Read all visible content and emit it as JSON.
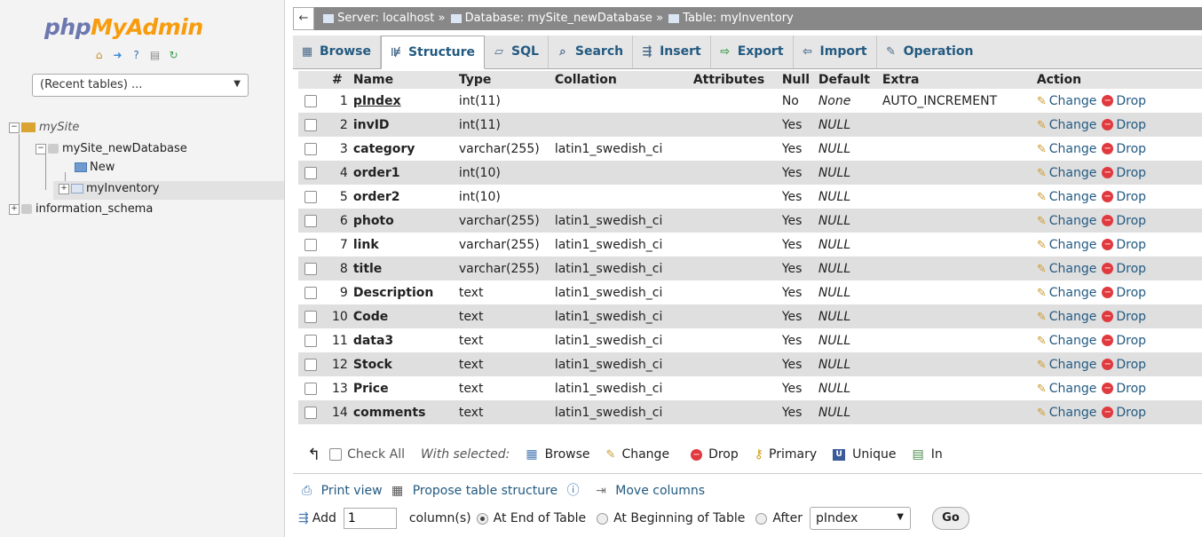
{
  "sidebar": {
    "logo_part1": "php",
    "logo_part2": "MyAdmin",
    "quick_icons": [
      "home-icon",
      "exit-icon",
      "help-icon",
      "docs-icon",
      "reload-icon"
    ],
    "recent_tables": "(Recent tables) ...",
    "tree": {
      "server": "mySite",
      "database": "mySite_newDatabase",
      "new_label": "New",
      "table": "myInventory",
      "other_db": "information_schema"
    }
  },
  "breadcrumb": {
    "back": "←",
    "server": "Server: localhost",
    "database": "Database: mySite_newDatabase",
    "table": "Table: myInventory",
    "separator": "»"
  },
  "tabs": [
    {
      "label": "Browse",
      "icon": "browse-icon"
    },
    {
      "label": "Structure",
      "icon": "structure-icon"
    },
    {
      "label": "SQL",
      "icon": "sql-icon"
    },
    {
      "label": "Search",
      "icon": "search-icon"
    },
    {
      "label": "Insert",
      "icon": "insert-icon"
    },
    {
      "label": "Export",
      "icon": "export-icon"
    },
    {
      "label": "Import",
      "icon": "import-icon"
    },
    {
      "label": "Operation",
      "icon": "operations-icon"
    }
  ],
  "table": {
    "headers": {
      "num": "#",
      "name": "Name",
      "type": "Type",
      "collation": "Collation",
      "attributes": "Attributes",
      "null": "Null",
      "default": "Default",
      "extra": "Extra",
      "action": "Action"
    },
    "change_label": "Change",
    "drop_label": "Drop",
    "rows": [
      {
        "num": "1",
        "name": "pIndex",
        "type": "int(11)",
        "collation": "",
        "null": "No",
        "default": "None",
        "extra": "AUTO_INCREMENT"
      },
      {
        "num": "2",
        "name": "invID",
        "type": "int(11)",
        "collation": "",
        "null": "Yes",
        "default": "NULL",
        "extra": ""
      },
      {
        "num": "3",
        "name": "category",
        "type": "varchar(255)",
        "collation": "latin1_swedish_ci",
        "null": "Yes",
        "default": "NULL",
        "extra": ""
      },
      {
        "num": "4",
        "name": "order1",
        "type": "int(10)",
        "collation": "",
        "null": "Yes",
        "default": "NULL",
        "extra": ""
      },
      {
        "num": "5",
        "name": "order2",
        "type": "int(10)",
        "collation": "",
        "null": "Yes",
        "default": "NULL",
        "extra": ""
      },
      {
        "num": "6",
        "name": "photo",
        "type": "varchar(255)",
        "collation": "latin1_swedish_ci",
        "null": "Yes",
        "default": "NULL",
        "extra": ""
      },
      {
        "num": "7",
        "name": "link",
        "type": "varchar(255)",
        "collation": "latin1_swedish_ci",
        "null": "Yes",
        "default": "NULL",
        "extra": ""
      },
      {
        "num": "8",
        "name": "title",
        "type": "varchar(255)",
        "collation": "latin1_swedish_ci",
        "null": "Yes",
        "default": "NULL",
        "extra": ""
      },
      {
        "num": "9",
        "name": "Description",
        "type": "text",
        "collation": "latin1_swedish_ci",
        "null": "Yes",
        "default": "NULL",
        "extra": ""
      },
      {
        "num": "10",
        "name": "Code",
        "type": "text",
        "collation": "latin1_swedish_ci",
        "null": "Yes",
        "default": "NULL",
        "extra": ""
      },
      {
        "num": "11",
        "name": "data3",
        "type": "text",
        "collation": "latin1_swedish_ci",
        "null": "Yes",
        "default": "NULL",
        "extra": ""
      },
      {
        "num": "12",
        "name": "Stock",
        "type": "text",
        "collation": "latin1_swedish_ci",
        "null": "Yes",
        "default": "NULL",
        "extra": ""
      },
      {
        "num": "13",
        "name": "Price",
        "type": "text",
        "collation": "latin1_swedish_ci",
        "null": "Yes",
        "default": "NULL",
        "extra": ""
      },
      {
        "num": "14",
        "name": "comments",
        "type": "text",
        "collation": "latin1_swedish_ci",
        "null": "Yes",
        "default": "NULL",
        "extra": ""
      }
    ]
  },
  "with_selected": {
    "check_all": "Check All",
    "label": "With selected:",
    "browse": "Browse",
    "change": "Change",
    "drop": "Drop",
    "primary": "Primary",
    "unique": "Unique",
    "index": "In"
  },
  "links": {
    "print_view": "Print view",
    "propose": "Propose table structure",
    "move_columns": "Move columns"
  },
  "add_columns": {
    "add_label": "Add",
    "count": "1",
    "columns_label": "column(s)",
    "at_end": "At End of Table",
    "at_beginning": "At Beginning of Table",
    "after": "After",
    "after_value": "pIndex",
    "go": "Go"
  },
  "colors": {
    "link": "#235a81",
    "logo_php": "#6c78af",
    "logo_myadmin": "#f89c0e",
    "drop_red": "#e0393e"
  }
}
